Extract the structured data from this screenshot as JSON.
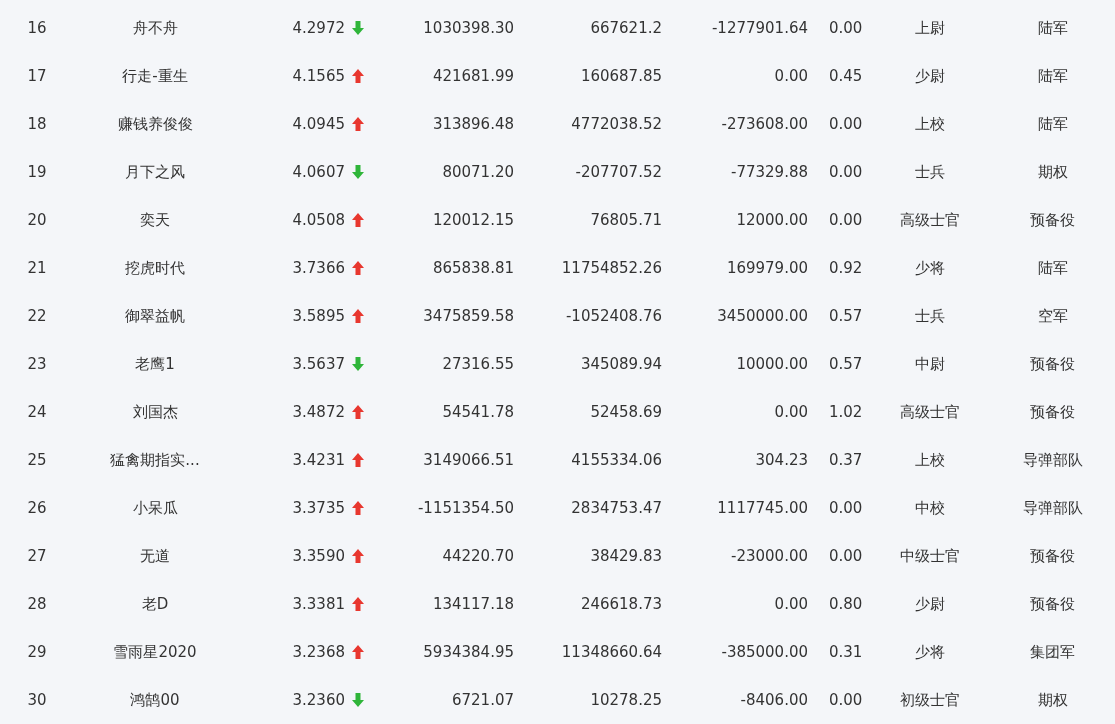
{
  "rows": [
    {
      "rank": "16",
      "name": "舟不舟",
      "score": "4.2972",
      "kind": "down",
      "column_4": "1030398.30",
      "column_5": "667621.2",
      "column_6": "-1277901.64",
      "column_7": "0.00",
      "rank_title": "上尉",
      "branch": "陆军"
    },
    {
      "rank": "17",
      "name": "行走-重生",
      "score": "4.1565",
      "kind": "up",
      "column_4": "421681.99",
      "column_5": "160687.85",
      "column_6": "0.00",
      "column_7": "0.45",
      "rank_title": "少尉",
      "branch": "陆军"
    },
    {
      "rank": "18",
      "name": "赚钱养俊俊",
      "score": "4.0945",
      "kind": "up",
      "column_4": "313896.48",
      "column_5": "4772038.52",
      "column_6": "-273608.00",
      "column_7": "0.00",
      "rank_title": "上校",
      "branch": "陆军"
    },
    {
      "rank": "19",
      "name": "月下之风",
      "score": "4.0607",
      "kind": "down",
      "column_4": "80071.20",
      "column_5": "-207707.52",
      "column_6": "-77329.88",
      "column_7": "0.00",
      "rank_title": "士兵",
      "branch": "期权"
    },
    {
      "rank": "20",
      "name": "奕天",
      "score": "4.0508",
      "kind": "up",
      "column_4": "120012.15",
      "column_5": "76805.71",
      "column_6": "12000.00",
      "column_7": "0.00",
      "rank_title": "高级士官",
      "branch": "预备役"
    },
    {
      "rank": "21",
      "name": "挖虎时代",
      "score": "3.7366",
      "kind": "up",
      "column_4": "865838.81",
      "column_5": "11754852.26",
      "column_6": "169979.00",
      "column_7": "0.92",
      "rank_title": "少将",
      "branch": "陆军"
    },
    {
      "rank": "22",
      "name": "御翠益帆",
      "score": "3.5895",
      "kind": "up",
      "column_4": "3475859.58",
      "column_5": "-1052408.76",
      "column_6": "3450000.00",
      "column_7": "0.57",
      "rank_title": "士兵",
      "branch": "空军"
    },
    {
      "rank": "23",
      "name": "老鹰1",
      "score": "3.5637",
      "kind": "down",
      "column_4": "27316.55",
      "column_5": "345089.94",
      "column_6": "10000.00",
      "column_7": "0.57",
      "rank_title": "中尉",
      "branch": "预备役"
    },
    {
      "rank": "24",
      "name": "刘国杰",
      "score": "3.4872",
      "kind": "up",
      "column_4": "54541.78",
      "column_5": "52458.69",
      "column_6": "0.00",
      "column_7": "1.02",
      "rank_title": "高级士官",
      "branch": "预备役"
    },
    {
      "rank": "25",
      "name": "猛禽期指实...",
      "score": "3.4231",
      "kind": "up",
      "column_4": "3149066.51",
      "column_5": "4155334.06",
      "column_6": "304.23",
      "column_7": "0.37",
      "rank_title": "上校",
      "branch": "导弹部队"
    },
    {
      "rank": "26",
      "name": "小呆瓜",
      "score": "3.3735",
      "kind": "up",
      "column_4": "-1151354.50",
      "column_5": "2834753.47",
      "column_6": "1117745.00",
      "column_7": "0.00",
      "rank_title": "中校",
      "branch": "导弹部队"
    },
    {
      "rank": "27",
      "name": "无道",
      "score": "3.3590",
      "kind": "up",
      "column_4": "44220.70",
      "column_5": "38429.83",
      "column_6": "-23000.00",
      "column_7": "0.00",
      "rank_title": "中级士官",
      "branch": "预备役"
    },
    {
      "rank": "28",
      "name": "老D",
      "score": "3.3381",
      "kind": "up",
      "column_4": "134117.18",
      "column_5": "246618.73",
      "column_6": "0.00",
      "column_7": "0.80",
      "rank_title": "少尉",
      "branch": "预备役"
    },
    {
      "rank": "29",
      "name": "雪雨星2020",
      "score": "3.2368",
      "kind": "up",
      "column_4": "5934384.95",
      "column_5": "11348660.64",
      "column_6": "-385000.00",
      "column_7": "0.31",
      "rank_title": "少将",
      "branch": "集团军"
    },
    {
      "rank": "30",
      "name": "鸿鹄00",
      "score": "3.2360",
      "kind": "down",
      "column_4": "6721.07",
      "column_5": "10278.25",
      "column_6": "-8406.00",
      "column_7": "0.00",
      "rank_title": "初级士官",
      "branch": "期权"
    }
  ]
}
